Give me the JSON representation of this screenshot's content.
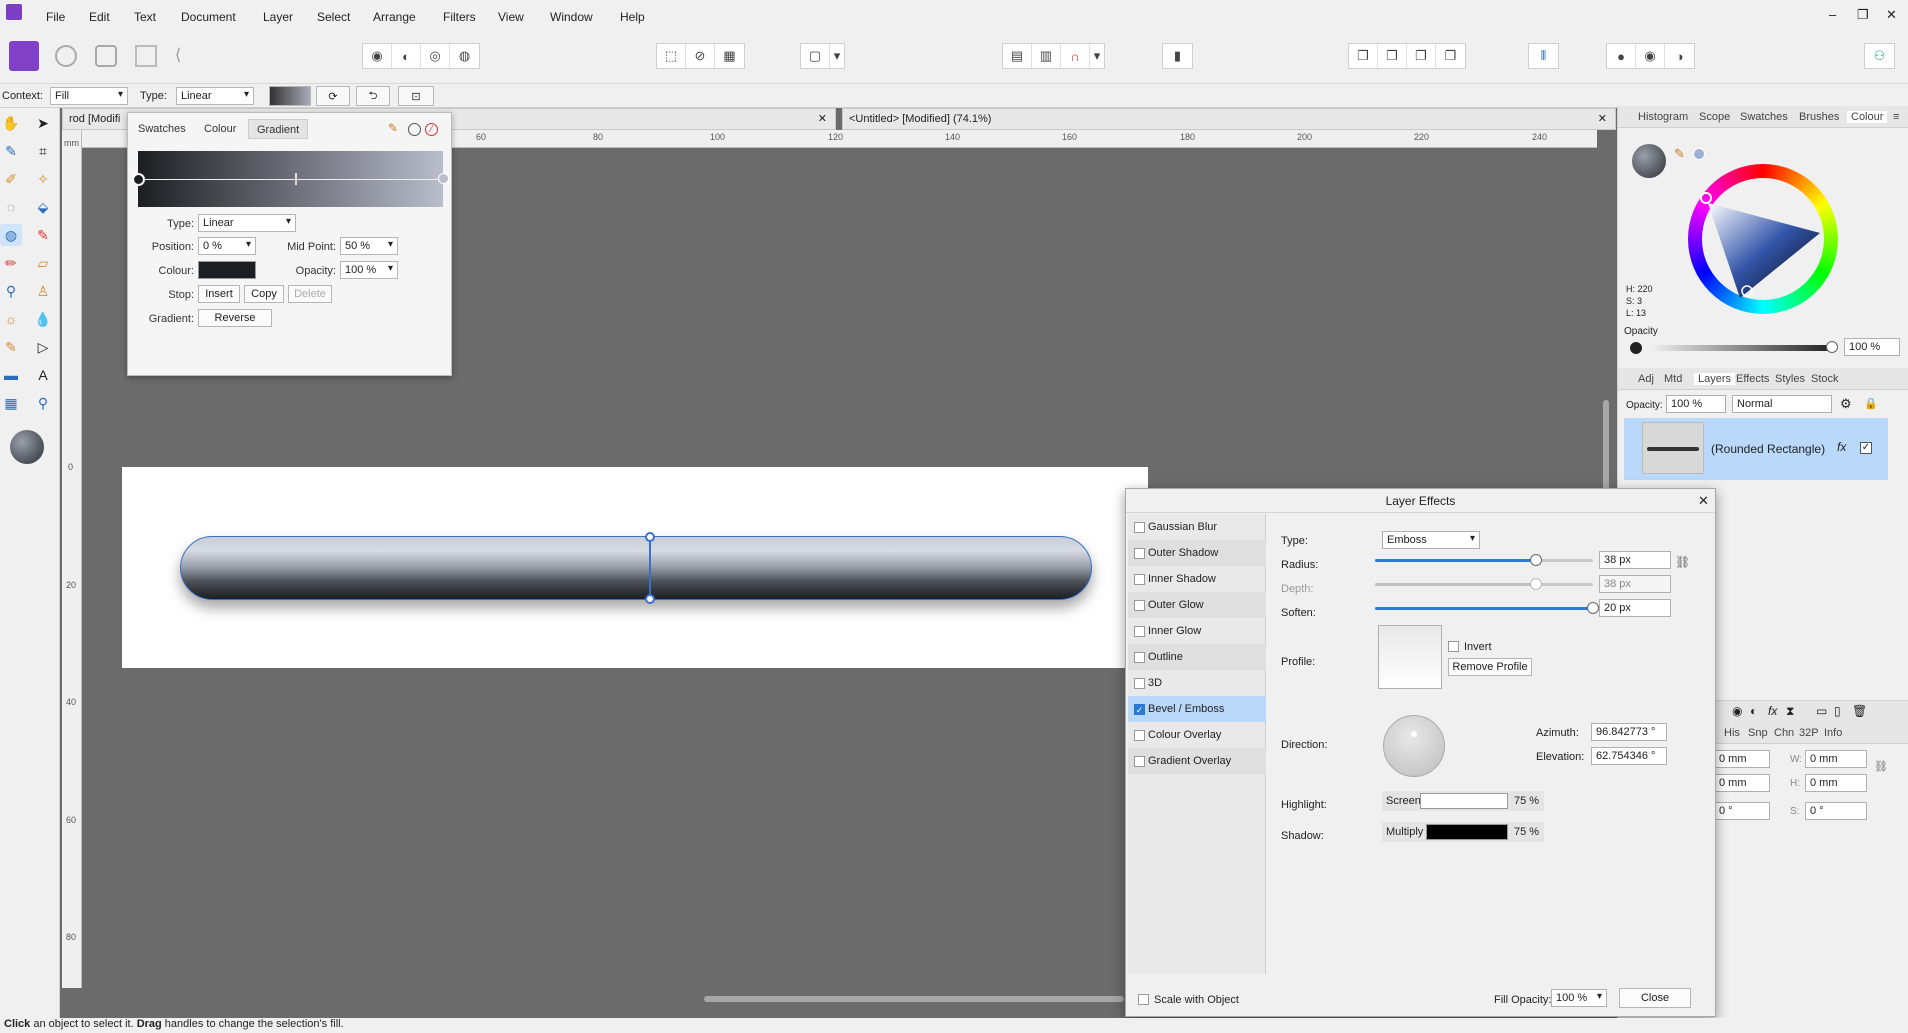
{
  "menu": [
    "File",
    "Edit",
    "Text",
    "Document",
    "Layer",
    "Select",
    "Arrange",
    "Filters",
    "View",
    "Window",
    "Help"
  ],
  "window_buttons": [
    "–",
    "❐",
    "✕"
  ],
  "context_bar": {
    "context_label": "Context:",
    "context_value": "Fill",
    "type_label": "Type:",
    "type_value": "Linear"
  },
  "doc_tabs": {
    "tab1": "rod [Modifi",
    "tab2": "<Untitled> [Modified] (74.1%)",
    "close": "✕"
  },
  "ruler_top": [
    "60",
    "80",
    "100",
    "120",
    "140",
    "160",
    "180",
    "200",
    "220",
    "240"
  ],
  "ruler_left": [
    "0",
    "20",
    "40",
    "60",
    "80"
  ],
  "ruler_unit": "mm",
  "gradient_popup": {
    "tabs": [
      "Swatches",
      "Colour",
      "Gradient"
    ],
    "type_label": "Type:",
    "type_value": "Linear",
    "position_label": "Position:",
    "position_value": "0 %",
    "midpoint_label": "Mid Point:",
    "midpoint_value": "50 %",
    "colour_label": "Colour:",
    "opacity_label": "Opacity:",
    "opacity_value": "100 %",
    "stop_label": "Stop:",
    "insert": "Insert",
    "copy": "Copy",
    "delete": "Delete",
    "gradient_label": "Gradient:",
    "reverse": "Reverse"
  },
  "colour_panel": {
    "tabs": [
      "Histogram",
      "Scope",
      "Swatches",
      "Brushes",
      "Colour"
    ],
    "h": "H: 220",
    "s": "S: 3",
    "l": "L: 13",
    "opacity_label": "Opacity",
    "opacity_value": "100 %"
  },
  "layers_panel": {
    "tabs": [
      "Adj",
      "Mtd",
      "Layers",
      "Effects",
      "Styles",
      "Stock"
    ],
    "opacity_label": "Opacity:",
    "opacity_value": "100 %",
    "blend_value": "Normal",
    "layer_name": "(Rounded Rectangle)",
    "fx": "fx"
  },
  "transform_panel": {
    "tabs": [
      "His",
      "Snp",
      "Chn",
      "32P",
      "Info"
    ],
    "x_value": "0 mm",
    "y_value": "0 mm",
    "w_label": "W:",
    "w_value": "0 mm",
    "h_label": "H:",
    "h_value": "0 mm",
    "r_value": "0 °",
    "s_label": "S:",
    "s_value": "0 °"
  },
  "layer_effects": {
    "title": "Layer Effects",
    "effects": [
      {
        "label": "Gaussian Blur",
        "checked": false
      },
      {
        "label": "Outer Shadow",
        "checked": false
      },
      {
        "label": "Inner Shadow",
        "checked": false
      },
      {
        "label": "Outer Glow",
        "checked": false
      },
      {
        "label": "Inner Glow",
        "checked": false
      },
      {
        "label": "Outline",
        "checked": false
      },
      {
        "label": "3D",
        "checked": false
      },
      {
        "label": "Bevel / Emboss",
        "checked": true
      },
      {
        "label": "Colour Overlay",
        "checked": false
      },
      {
        "label": "Gradient Overlay",
        "checked": false
      }
    ],
    "type_label": "Type:",
    "type_value": "Emboss",
    "radius_label": "Radius:",
    "radius_value": "38 px",
    "radius_level": 0.74,
    "depth_label": "Depth:",
    "depth_value": "38 px",
    "depth_level": 0.74,
    "soften_label": "Soften:",
    "soften_value": "20 px",
    "soften_level": 1.0,
    "profile_label": "Profile:",
    "invert_label": "Invert",
    "remove_profile": "Remove Profile",
    "direction_label": "Direction:",
    "azimuth_label": "Azimuth:",
    "azimuth_value": "96.842773 °",
    "elevation_label": "Elevation:",
    "elevation_value": "62.754346 °",
    "highlight_label": "Highlight:",
    "highlight_mode": "Screen",
    "highlight_opacity": "75 %",
    "shadow_label": "Shadow:",
    "shadow_mode": "Multiply",
    "shadow_opacity": "75 %",
    "scale_with_object": "Scale with Object",
    "fill_opacity_label": "Fill Opacity:",
    "fill_opacity_value": "100 %",
    "close": "Close"
  },
  "status": {
    "part1": "Click",
    "part2": " an object to select it. ",
    "part3": "Drag",
    "part4": " handles to change the selection's fill."
  },
  "colors": {
    "accent": "#2f7bd6",
    "selected_row": "#b9d8fa",
    "canvas": "#6b6b6b"
  }
}
